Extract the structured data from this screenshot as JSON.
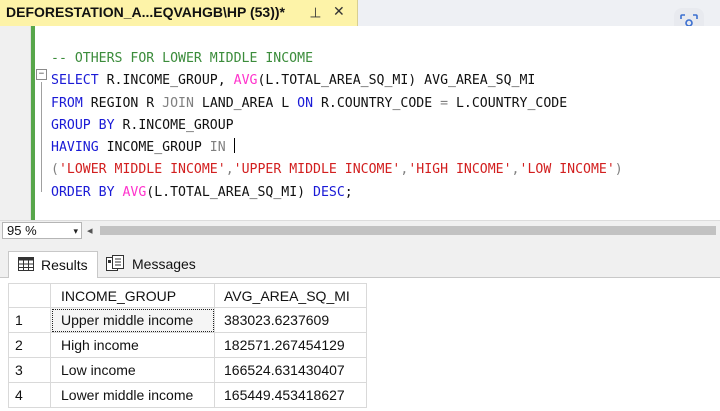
{
  "document_tab": {
    "title": "DEFORESTATION_A...EQVAHGB\\HP (53))*",
    "pin_glyph": "⊣",
    "close_glyph": "✕"
  },
  "editor": {
    "comment": "-- OTHERS FOR LOWER MIDDLE INCOME",
    "line2": {
      "kw1": "SELECT",
      "t1": " R.INCOME_GROUP, ",
      "fn": "AVG",
      "t2": "(L.TOTAL_AREA_SQ_MI) AVG_AREA_SQ_MI"
    },
    "line3": {
      "kw1": "FROM",
      "t1": " REGION R ",
      "gray1": "JOIN",
      "t2": " LAND_AREA L ",
      "kw2": "ON",
      "t3": " R.COUNTRY_CODE ",
      "gray2": "=",
      "t4": " L.COUNTRY_CODE"
    },
    "line4": {
      "kw1": "GROUP BY",
      "t1": " R.INCOME_GROUP"
    },
    "line5": {
      "kw1": "HAVING",
      "t1": " INCOME_GROUP ",
      "gray1": "IN"
    },
    "line6": {
      "p1": "(",
      "s1": "'LOWER MIDDLE INCOME'",
      "c1": ",",
      "s2": "'UPPER MIDDLE INCOME'",
      "c2": ",",
      "s3": "'HIGH INCOME'",
      "c3": ",",
      "s4": "'LOW INCOME'",
      "p2": ")"
    },
    "line7": {
      "kw1": "ORDER BY",
      "fn": " AVG",
      "t1": "(L.TOTAL_AREA_SQ_MI) ",
      "kw2": "DESC",
      "t2": ";"
    },
    "fold_marker": "−"
  },
  "zoom": {
    "value": "95 %",
    "caret": "▾"
  },
  "results_tabs": {
    "results_label": "Results",
    "messages_label": "Messages"
  },
  "grid": {
    "columns": [
      "",
      "INCOME_GROUP",
      "AVG_AREA_SQ_MI"
    ],
    "rows": [
      {
        "num": "1",
        "income_group": "Upper middle income",
        "avg_area": "383023.6237609"
      },
      {
        "num": "2",
        "income_group": "High income",
        "avg_area": "182571.267454129"
      },
      {
        "num": "3",
        "income_group": "Low income",
        "avg_area": "166524.631430407"
      },
      {
        "num": "4",
        "income_group": "Lower middle income",
        "avg_area": "165449.453418627"
      }
    ]
  },
  "colors": {
    "tab_active": "#fdf3a8",
    "keyword": "#1a1ad6",
    "function": "#ff33cc",
    "comment": "#3b8c3b",
    "string": "#d21f1f",
    "change_bar": "#57a64a"
  }
}
